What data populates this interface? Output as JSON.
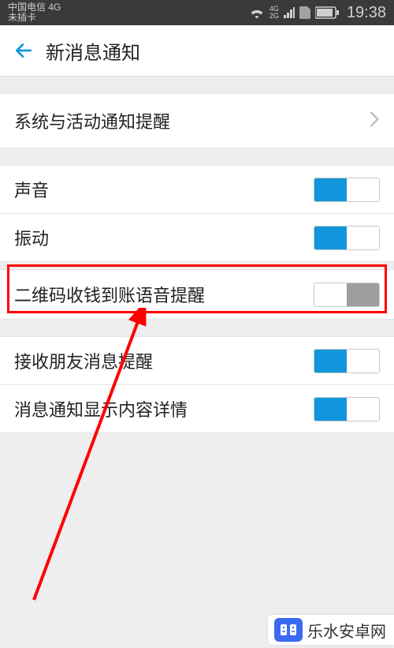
{
  "status": {
    "carrier": "中国电信 4G",
    "sim": "未插卡",
    "time": "19:38",
    "net_label": "4G",
    "net_label2": "2G"
  },
  "nav": {
    "title": "新消息通知"
  },
  "rows": {
    "system": {
      "label": "系统与活动通知提醒"
    },
    "sound": {
      "label": "声音",
      "on": true
    },
    "vibrate": {
      "label": "振动",
      "on": true
    },
    "qr_voice": {
      "label": "二维码收钱到账语音提醒",
      "on": false
    },
    "friend_msg": {
      "label": "接收朋友消息提醒",
      "on": true
    },
    "show_detail": {
      "label": "消息通知显示内容详情",
      "on": true
    }
  },
  "watermark": {
    "text": "乐水安卓网"
  }
}
